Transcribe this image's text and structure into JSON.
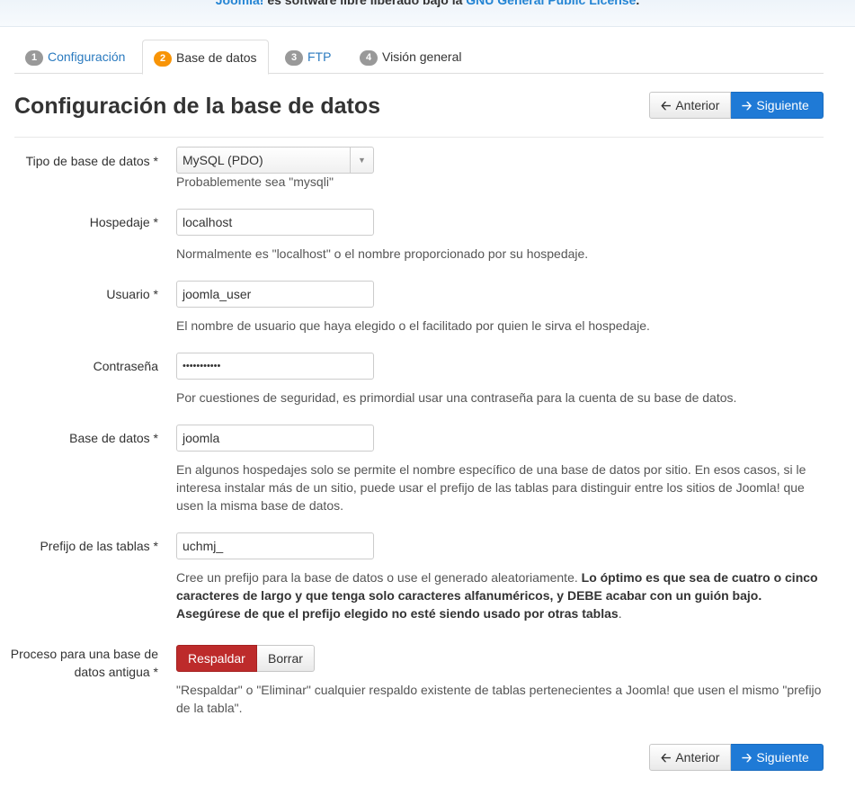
{
  "banner": {
    "brand": "Joomla!",
    "text": " es software libre liberado bajo la ",
    "license": "GNU General Public License",
    "end": "."
  },
  "tabs": [
    {
      "num": "1",
      "label": "Configuración"
    },
    {
      "num": "2",
      "label": "Base de datos"
    },
    {
      "num": "3",
      "label": "FTP"
    },
    {
      "num": "4",
      "label": "Visión general"
    }
  ],
  "page_title": "Configuración de la base de datos",
  "nav": {
    "prev_label": "Anterior",
    "next_label": "Siguiente"
  },
  "form": {
    "db_type": {
      "label": "Tipo de base de datos *",
      "value": "MySQL (PDO)",
      "help": "Probablemente sea \"mysqli\""
    },
    "host": {
      "label": "Hospedaje *",
      "value": "localhost",
      "help": "Normalmente es \"localhost\" o el nombre proporcionado por su hospedaje."
    },
    "user": {
      "label": "Usuario *",
      "value": "joomla_user",
      "help": "El nombre de usuario que haya elegido o el facilitado por quien le sirva el hospedaje."
    },
    "password": {
      "label": "Contraseña",
      "value": "•••••••••••",
      "help": "Por cuestiones de seguridad, es primordial usar una contraseña para la cuenta de su base de datos."
    },
    "database": {
      "label": "Base de datos *",
      "value": "joomla",
      "help": "En algunos hospedajes solo se permite el nombre específico de una base de datos por sitio. En esos casos, si le interesa instalar más de un sitio, puede usar el prefijo de las tablas para distinguir entre los sitios de Joomla! que usen la misma base de datos."
    },
    "prefix": {
      "label": "Prefijo de las tablas *",
      "value": "uchmj_",
      "help_plain": "Cree un prefijo para la base de datos o use el generado aleatoriamente. ",
      "help_bold_1": "Lo óptimo es que sea de cuatro o cinco caracteres de largo y que tenga solo caracteres alfanuméricos, y DEBE acabar con un guión bajo. Asegúrese de que el prefijo elegido no esté siendo usado por otras tablas",
      "help_end": "."
    },
    "old_db": {
      "label": "Proceso para una base de datos antigua *",
      "backup_label": "Respaldar",
      "delete_label": "Borrar",
      "help": "\"Respaldar\" o \"Eliminar\" cualquier respaldo existente de tablas pertenecientes a Joomla! que usen el mismo \"prefijo de la tabla\"."
    }
  },
  "colors": {
    "primary": "#1f7ad6",
    "danger": "#bd2b2b",
    "badge_active": "#f89406",
    "link": "#2384d3"
  }
}
